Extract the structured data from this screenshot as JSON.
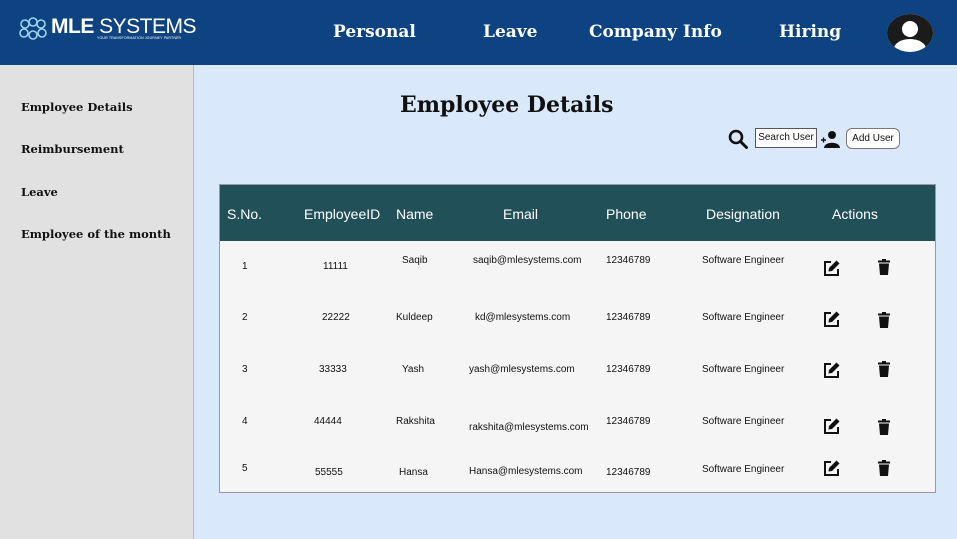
{
  "brand": {
    "name_bold": "MLE",
    "name_rest": " SYSTEMS",
    "tagline": "YOUR TRANSFORMATION JOURNEY PARTNER"
  },
  "nav": [
    "Personal",
    "Leave",
    "Company Info",
    "Hiring"
  ],
  "sidebar": [
    "Employee Details",
    "Reimbursement",
    "Leave",
    "Employee of the month"
  ],
  "page": {
    "title": "Employee Details"
  },
  "toolbar": {
    "search_value": "Search User",
    "add_label": "Add User"
  },
  "table": {
    "headers": [
      "S.No.",
      "EmployeeID",
      "Name",
      "Email",
      "Phone",
      "Designation",
      "Actions"
    ],
    "rows": [
      [
        "1",
        "11111",
        "Saqib",
        "saqib@mlesystems.com",
        "12346789",
        "Software Engineer"
      ],
      [
        "2",
        "22222",
        "Kuldeep",
        "kd@mlesystems.com",
        "12346789",
        "Software Engineer"
      ],
      [
        "3",
        "33333",
        "Yash",
        "yash@mlesystems.com",
        "12346789",
        "Software Engineer"
      ],
      [
        "4",
        "44444",
        "Rakshita",
        "rakshita@mlesystems.com",
        "12346789",
        "Software Engineer"
      ],
      [
        "5",
        "55555",
        "Hansa",
        "Hansa@mlesystems.com",
        "12346789",
        "Software Engineer"
      ]
    ]
  },
  "icons": {
    "search": "search-icon",
    "add_user": "add-user-icon",
    "edit": "edit-icon",
    "delete": "trash-icon",
    "avatar": "user-avatar-icon"
  },
  "colors": {
    "header": "#0e4382",
    "table_header": "#225059",
    "content_bg": "#dae8fc",
    "sidebar_bg": "#e1e1e1"
  }
}
